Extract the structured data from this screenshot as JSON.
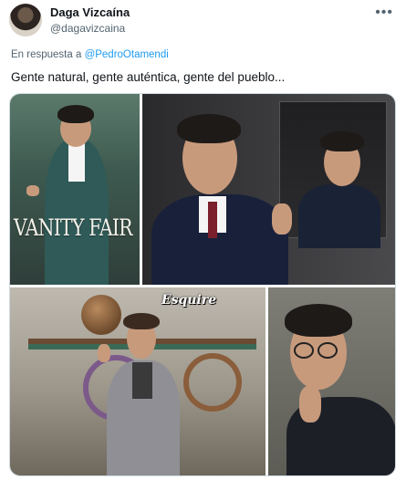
{
  "header": {
    "display_name": "Daga Vizcaína",
    "handle": "@dagavizcaina",
    "more_icon": "more-dots-icon"
  },
  "reply": {
    "prefix": "En respuesta a",
    "mention": "@PedroOtamendi"
  },
  "tweet": {
    "text": "Gente natural, gente auténtica, gente del pueblo..."
  },
  "media": {
    "images": [
      {
        "name": "vanity-fair-cover",
        "caption": "VANITY FAIR"
      },
      {
        "name": "mirror-portrait",
        "caption": ""
      },
      {
        "name": "esquire-cover",
        "caption": "Esquire"
      },
      {
        "name": "glasses-portrait",
        "caption": ""
      }
    ]
  },
  "colors": {
    "link": "#1d9bf0",
    "secondary_text": "#536471",
    "border": "#cfd9de"
  }
}
